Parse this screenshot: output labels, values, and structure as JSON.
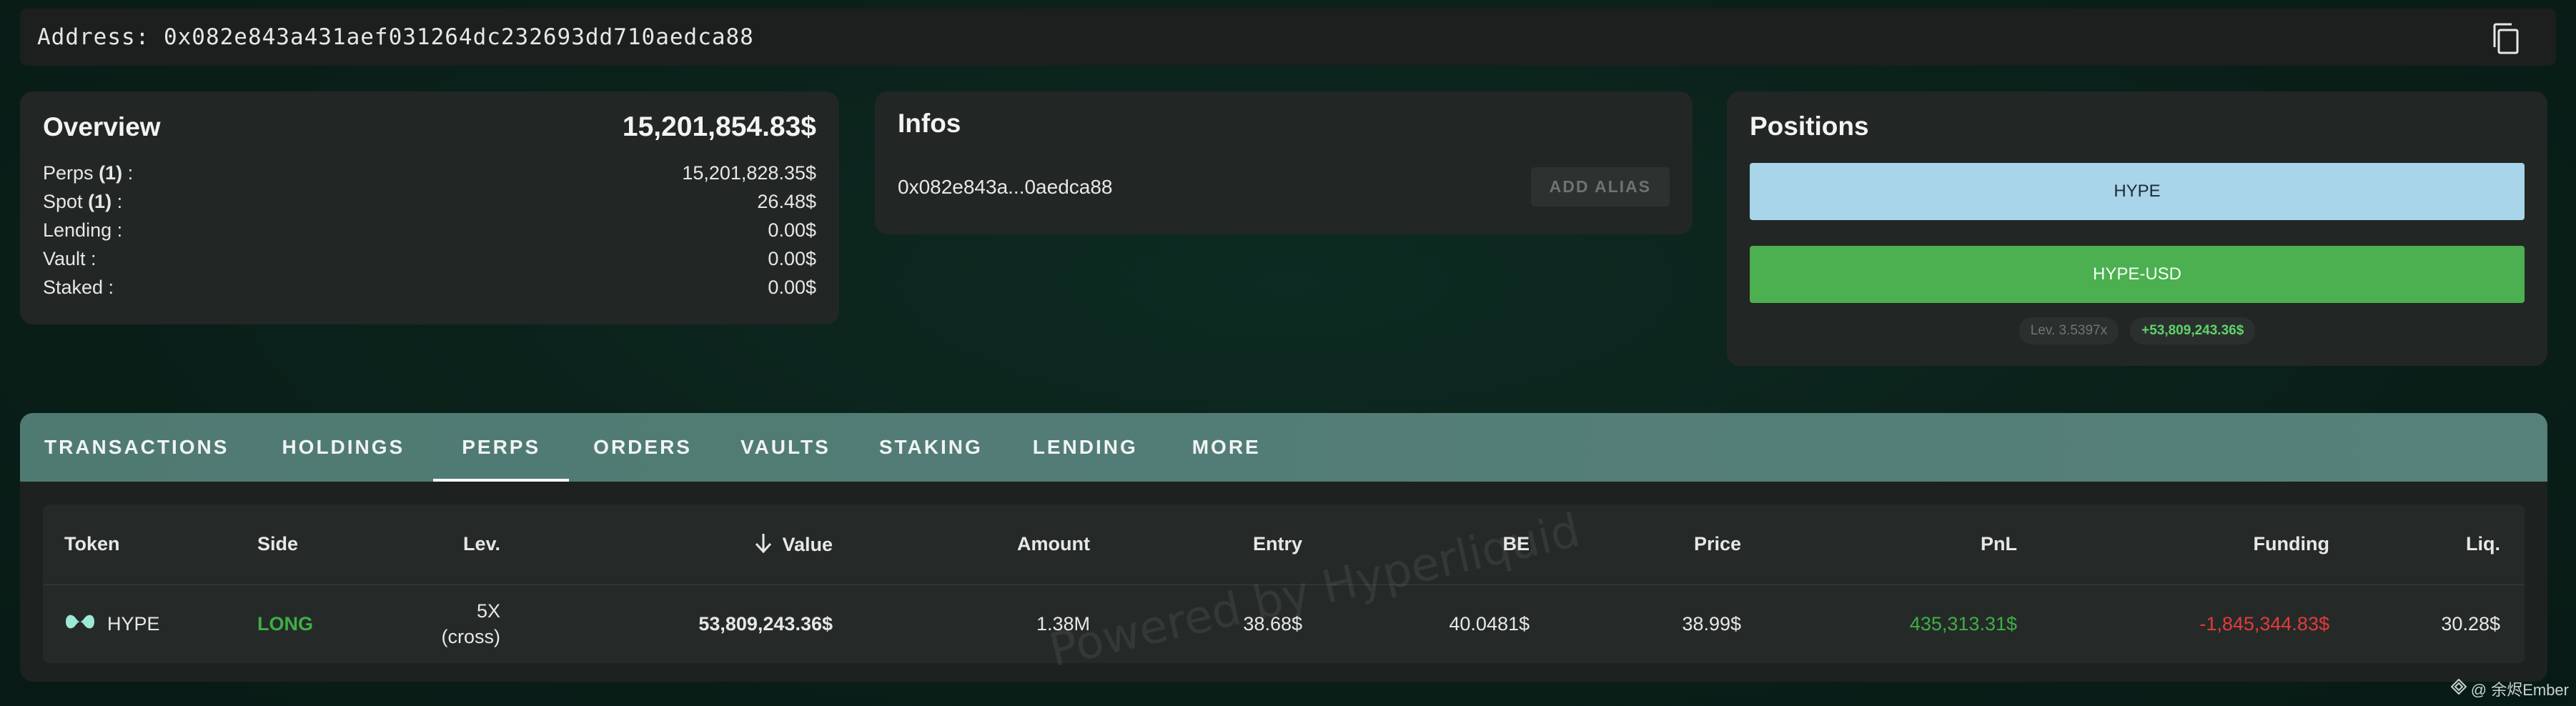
{
  "address": {
    "label": "Address: 0x082e843a431aef031264dc232693dd710aedca88",
    "copy_icon": "copy-icon"
  },
  "overview": {
    "title": "Overview",
    "total": "15,201,854.83$",
    "rows": [
      {
        "label": "Perps",
        "count": "(1)",
        "suffix": " :",
        "value": "15,201,828.35$"
      },
      {
        "label": "Spot",
        "count": "(1)",
        "suffix": " :",
        "value": "26.48$"
      },
      {
        "label": "Lending :",
        "count": "",
        "suffix": "",
        "value": "0.00$"
      },
      {
        "label": "Vault :",
        "count": "",
        "suffix": "",
        "value": "0.00$"
      },
      {
        "label": "Staked :",
        "count": "",
        "suffix": "",
        "value": "0.00$"
      }
    ]
  },
  "infos": {
    "title": "Infos",
    "short_address": "0x082e843a...0aedca88",
    "alias_button": "ADD ALIAS"
  },
  "positions": {
    "title": "Positions",
    "buttons": [
      "HYPE",
      "HYPE-USD"
    ],
    "lev_tag": "Lev. 3.5397x",
    "pnl_tag": "+53,809,243.36$"
  },
  "tabs": [
    "TRANSACTIONS",
    "HOLDINGS",
    "PERPS",
    "ORDERS",
    "VAULTS",
    "STAKING",
    "LENDING",
    "MORE"
  ],
  "active_tab": "PERPS",
  "table": {
    "headers": [
      "Token",
      "Side",
      "Lev.",
      "Value",
      "Amount",
      "Entry",
      "BE",
      "Price",
      "PnL",
      "Funding",
      "Liq."
    ],
    "sort_icon": "arrow-down-icon",
    "rows": [
      {
        "token": "HYPE",
        "side": "LONG",
        "lev_top": "5X",
        "lev_bottom": "(cross)",
        "value": "53,809,243.36$",
        "amount": "1.38M",
        "entry": "38.68$",
        "be": "40.0481$",
        "price": "38.99$",
        "pnl": "435,313.31$",
        "funding": "-1,845,344.83$",
        "liq": "30.28$"
      }
    ]
  },
  "watermark": "Powered by Hyperliquid",
  "credit": "@ 余烬Ember",
  "colors": {
    "accent_green": "#4caf50",
    "hype_blue": "#a8d5ea",
    "negative": "#e23b3b",
    "tab_bar": "#56807a"
  }
}
